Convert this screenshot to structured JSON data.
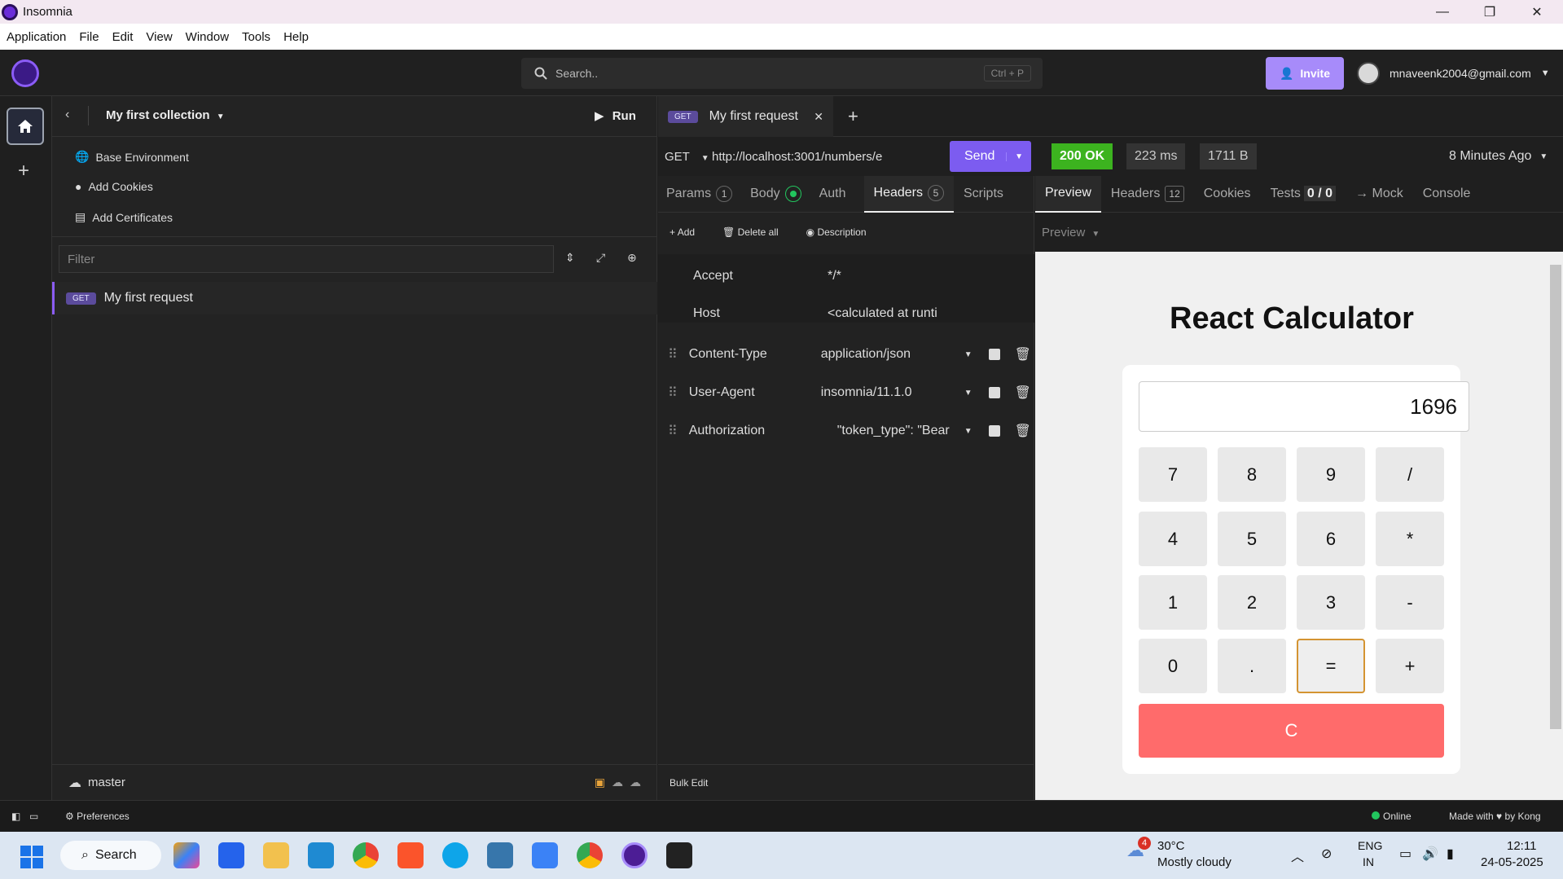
{
  "window": {
    "title": "Insomnia",
    "minimize": "—",
    "maximize": "❐",
    "close": "✕"
  },
  "menu": [
    "Application",
    "File",
    "Edit",
    "View",
    "Window",
    "Tools",
    "Help"
  ],
  "header": {
    "search_placeholder": "Search..",
    "search_shortcut": "Ctrl + P",
    "invite_label": "Invite",
    "user_email": "mnaveenk2004@gmail.com"
  },
  "sidebar": {
    "collection_name": "My first collection",
    "run_label": "Run",
    "items": [
      {
        "label": "Base Environment",
        "icon": "globe-icon"
      },
      {
        "label": "Add Cookies",
        "icon": "cookie-icon"
      },
      {
        "label": "Add Certificates",
        "icon": "certificate-icon"
      }
    ],
    "filter_placeholder": "Filter",
    "requests": [
      {
        "method": "GET",
        "name": "My first request"
      }
    ],
    "branch": "master"
  },
  "tab": {
    "method": "GET",
    "name": "My first request"
  },
  "request": {
    "method": "GET",
    "url": "http://localhost:3001/numbers/e",
    "send_label": "Send",
    "tabs": [
      {
        "label": "Params",
        "badge": "1"
      },
      {
        "label": "Body",
        "badge": ""
      },
      {
        "label": "Auth",
        "badge": ""
      },
      {
        "label": "Headers",
        "badge": "5"
      },
      {
        "label": "Scripts",
        "badge": ""
      }
    ],
    "actions": {
      "add": "Add",
      "delete_all": "Delete all",
      "description": "Description"
    },
    "auto_headers": [
      {
        "name": "Accept",
        "value": "*/*"
      },
      {
        "name": "Host",
        "value": "<calculated at runti"
      }
    ],
    "headers": [
      {
        "name": "Content-Type",
        "value": "application/json"
      },
      {
        "name": "User-Agent",
        "value": "insomnia/11.1.0"
      },
      {
        "name": "Authorization",
        "value": "\"token_type\": \"Bear"
      }
    ],
    "bulk_edit": "Bulk Edit"
  },
  "response": {
    "status": "200 OK",
    "time": "223 ms",
    "size": "1711 B",
    "age": "8 Minutes Ago",
    "tabs": [
      {
        "label": "Preview",
        "badge": ""
      },
      {
        "label": "Headers",
        "badge": "12"
      },
      {
        "label": "Cookies",
        "badge": ""
      },
      {
        "label": "Tests",
        "badge": "0 / 0"
      },
      {
        "label": "→ Mock",
        "badge": ""
      },
      {
        "label": "Console",
        "badge": ""
      }
    ],
    "preview_mode": "Preview"
  },
  "calculator": {
    "title": "React Calculator",
    "display": "1696",
    "keys": [
      "7",
      "8",
      "9",
      "/",
      "4",
      "5",
      "6",
      "*",
      "1",
      "2",
      "3",
      "-",
      "0",
      ".",
      "=",
      "+"
    ],
    "clear": "C"
  },
  "statusbar": {
    "preferences": "Preferences",
    "online": "Online",
    "made_with": "Made with",
    "by": "by Kong"
  },
  "taskbar": {
    "search": "Search",
    "weather_temp": "30°C",
    "weather_desc": "Mostly cloudy",
    "weather_badge": "4",
    "lang1": "ENG",
    "lang2": "IN",
    "time": "12:11",
    "date": "24-05-2025"
  },
  "colors": {
    "accent": "#7c5cf0",
    "status_ok": "#22c55e",
    "clear_button": "#ff6b6b"
  }
}
